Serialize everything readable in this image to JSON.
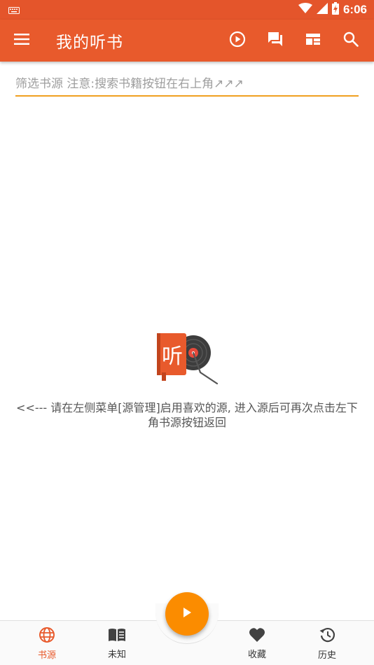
{
  "status_bar": {
    "time": "6:06",
    "icons": [
      "keyboard-icon",
      "wifi-icon",
      "signal-icon",
      "battery-charging-icon"
    ]
  },
  "app_bar": {
    "title": "我的听书",
    "icons": [
      "menu-icon",
      "play-circle-icon",
      "chat-icon",
      "dashboard-icon",
      "search-icon"
    ]
  },
  "filter": {
    "placeholder": "筛选书源 注意:搜索书籍按钮在右上角↗↗↗",
    "value": ""
  },
  "empty_state": {
    "logo_text": "听",
    "message": "<<--- 请在左侧菜单[源管理]启用喜欢的源, 进入源后可再次点击左下角书源按钮返回"
  },
  "bottom_nav": {
    "items": [
      {
        "label": "书源",
        "icon": "globe-icon",
        "active": true
      },
      {
        "label": "未知",
        "icon": "book-open-icon",
        "active": false
      },
      {
        "label": "收藏",
        "icon": "heart-icon",
        "active": false
      },
      {
        "label": "历史",
        "icon": "history-icon",
        "active": false
      }
    ],
    "fab_icon": "play-icon"
  },
  "colors": {
    "primary": "#e85a2c",
    "status_bar": "#e4552b",
    "accent": "#fb8c00",
    "underline": "#f0a020",
    "active_nav": "#e85a2c",
    "icon_dark": "#424242"
  }
}
